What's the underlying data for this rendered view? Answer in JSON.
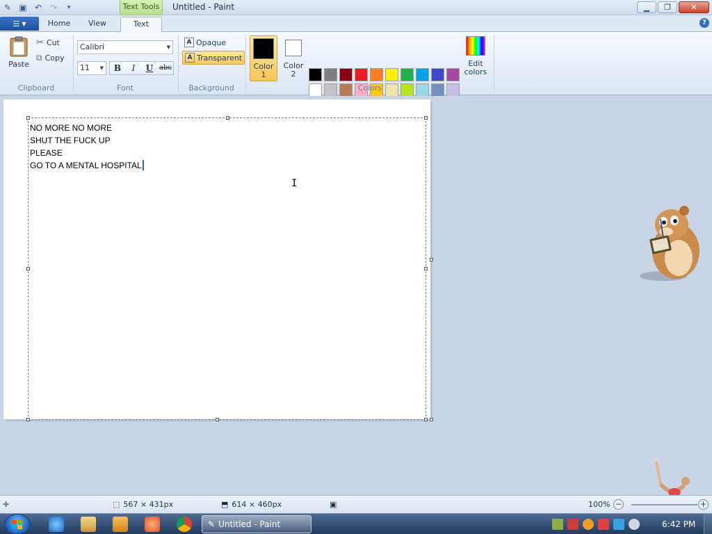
{
  "window": {
    "title": "Untitled - Paint",
    "context_tab": "Text Tools"
  },
  "tabs": {
    "home": "Home",
    "view": "View",
    "text": "Text"
  },
  "clipboard": {
    "paste": "Paste",
    "cut": "Cut",
    "copy": "Copy",
    "group": "Clipboard"
  },
  "font": {
    "family": "Calibri",
    "size": "11",
    "bold": "B",
    "italic": "I",
    "underline": "U",
    "strike": "abc",
    "group": "Font"
  },
  "background": {
    "opaque": "Opaque",
    "transparent": "Transparent",
    "group": "Background"
  },
  "colors": {
    "color1_l1": "Color",
    "color1_l2": "1",
    "color2_l1": "Color",
    "color2_l2": "2",
    "color1_value": "#000000",
    "color2_value": "#ffffff",
    "edit_l1": "Edit",
    "edit_l2": "colors",
    "group": "Colors",
    "palette_row1": [
      "#000000",
      "#7f7f7f",
      "#880015",
      "#ed1c24",
      "#ff7f27",
      "#fff200",
      "#22b14c",
      "#00a2e8",
      "#3f48cc",
      "#a349a4"
    ],
    "palette_row2": [
      "#ffffff",
      "#c3c3c3",
      "#b97a57",
      "#ffaec9",
      "#ffc90e",
      "#efe4b0",
      "#b5e61d",
      "#99d9ea",
      "#7092be",
      "#c8bfe7"
    ],
    "palette_row3": [
      "#e6ecf4",
      "#e6ecf4",
      "#e6ecf4",
      "#e6ecf4",
      "#e6ecf4",
      "#e6ecf4",
      "#e6ecf4",
      "#e6ecf4",
      "#e6ecf4",
      "#e6ecf4"
    ]
  },
  "canvas_text": {
    "line1": "NO MORE NO MORE",
    "line2": "SHUT THE FUCK UP",
    "line3": "PLEASE",
    "line4": "GO TO A MENTAL HOSPITAL"
  },
  "status": {
    "selection_size": "567 × 431px",
    "canvas_size": "614 × 460px",
    "zoom": "100%"
  },
  "taskbar": {
    "task_label": "Untitled - Paint",
    "clock": "6:42 PM"
  }
}
